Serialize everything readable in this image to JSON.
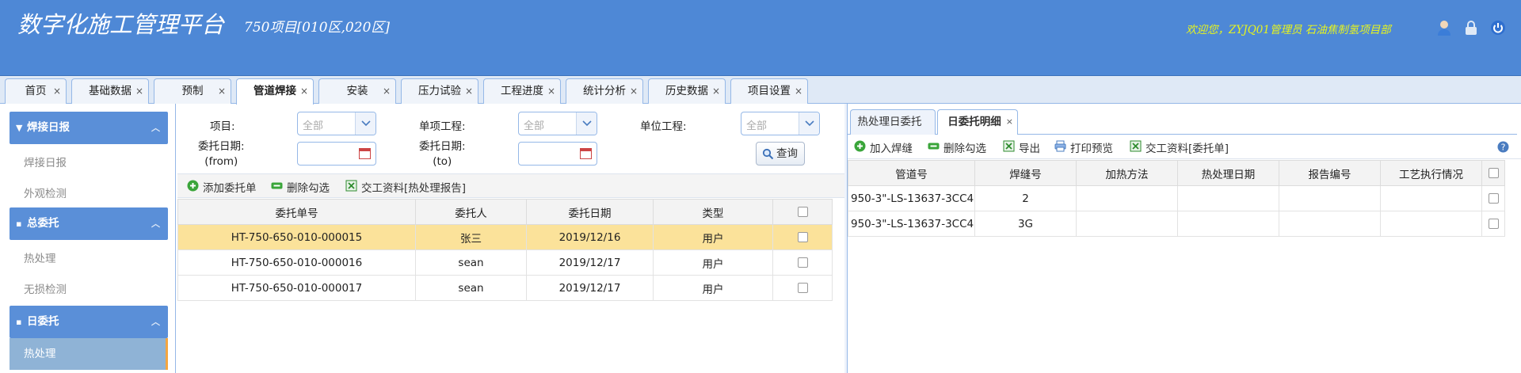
{
  "header": {
    "title": "数字化施工管理平台",
    "subtitle": "750项目[010区,020区]",
    "welcome": "欢迎您，ZYJQ01管理员 石油焦制氢项目部"
  },
  "tabs": [
    {
      "label": "首页"
    },
    {
      "label": "基础数据"
    },
    {
      "label": "预制"
    },
    {
      "label": "管道焊接"
    },
    {
      "label": "安装"
    },
    {
      "label": "压力试验"
    },
    {
      "label": "工程进度"
    },
    {
      "label": "统计分析"
    },
    {
      "label": "历史数据"
    },
    {
      "label": "项目设置"
    }
  ],
  "sidebar": {
    "groups": [
      {
        "title": "焊接日报",
        "items": [
          "焊接日报",
          "外观检测"
        ]
      },
      {
        "title": "总委托",
        "items": [
          "热处理",
          "无损检测"
        ]
      },
      {
        "title": "日委托",
        "items": [
          "热处理"
        ]
      }
    ]
  },
  "filters": {
    "project_label": "项目:",
    "subproject_label": "单项工程:",
    "unit_label": "单位工程:",
    "all_placeholder": "全部",
    "date_from_label_1": "委托日期:",
    "date_from_label_2": "(from)",
    "date_to_label_1": "委托日期:",
    "date_to_label_2": "(to)",
    "query_button": "查询"
  },
  "left_toolbar": {
    "add": "添加委托单",
    "delete": "删除勾选",
    "handover": "交工资料[热处理报告]"
  },
  "left_grid": {
    "columns": [
      "委托单号",
      "委托人",
      "委托日期",
      "类型"
    ],
    "rows": [
      [
        "HT-750-650-010-000015",
        "张三",
        "2019/12/16",
        "用户"
      ],
      [
        "HT-750-650-010-000016",
        "sean",
        "2019/12/17",
        "用户"
      ],
      [
        "HT-750-650-010-000017",
        "sean",
        "2019/12/17",
        "用户"
      ]
    ]
  },
  "right_tabs": [
    {
      "label": "热处理日委托"
    },
    {
      "label": "日委托明细"
    }
  ],
  "right_toolbar": {
    "add": "加入焊缝",
    "delete": "删除勾选",
    "export": "导出",
    "print": "打印预览",
    "handover": "交工资料[委托单]"
  },
  "right_grid": {
    "columns": [
      "管道号",
      "焊缝号",
      "加热方法",
      "热处理日期",
      "报告编号",
      "工艺执行情况"
    ],
    "rows": [
      [
        "950-3\"-LS-13637-3CC4",
        "2",
        "",
        "",
        "",
        ""
      ],
      [
        "950-3\"-LS-13637-3CC4",
        "3G",
        "",
        "",
        "",
        ""
      ]
    ]
  },
  "colors": {
    "header_bg": "#4e88d6",
    "accent": "#5a8fd8",
    "selected_row": "#fbe29a",
    "welcome_text": "#e8f51c"
  }
}
